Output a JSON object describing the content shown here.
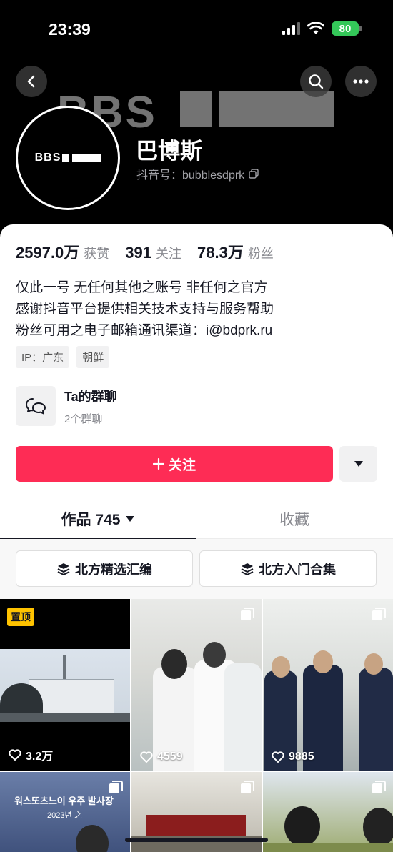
{
  "status_bar": {
    "time": "23:39",
    "battery": "80"
  },
  "profile": {
    "name": "巴博斯",
    "douyin_id": "抖音号：bubblesdprk",
    "avatar_text": "BBS",
    "banner_text": "BBS"
  },
  "stats": [
    {
      "value": "2597.0万",
      "label": "获赞"
    },
    {
      "value": "391",
      "label": "关注"
    },
    {
      "value": "78.3万",
      "label": "粉丝"
    }
  ],
  "bio": [
    "仅此一号  无任何其他之账号  非任何之官方",
    "感谢抖音平台提供相关技术支持与服务帮助",
    "粉丝可用之电子邮箱通讯渠道：i@bdprk.ru"
  ],
  "tags": [
    "IP：广东",
    "朝鲜"
  ],
  "group_chat": {
    "title": "Ta的群聊",
    "subtitle": "2个群聊"
  },
  "follow_label": "关注",
  "tabs": {
    "works": "作品 745",
    "favorites": "收藏"
  },
  "collections": [
    "北方精选汇编",
    "北方入门合集"
  ],
  "videos": [
    {
      "likes": "3.2万",
      "pinned": "置顶"
    },
    {
      "likes": "4559"
    },
    {
      "likes": "9885"
    },
    {
      "overlay_text": "워스또츠느이 우주 발사장",
      "date_text": "2023년 之"
    },
    {},
    {}
  ],
  "colors": {
    "accent": "#fe2c55",
    "battery": "#34c759",
    "pin": "#ffc300"
  }
}
